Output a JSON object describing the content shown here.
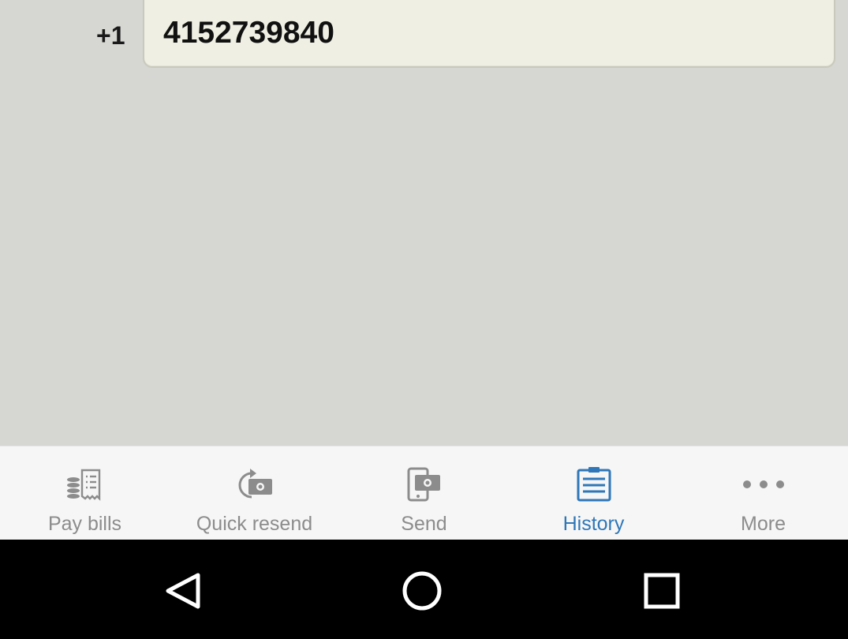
{
  "phone": {
    "country_code": "+1",
    "number": "4152739840"
  },
  "tabs": [
    {
      "id": "pay-bills",
      "label": "Pay bills",
      "icon": "receipt-coins-icon",
      "active": false
    },
    {
      "id": "quick-resend",
      "label": "Quick resend",
      "icon": "resend-money-icon",
      "active": false
    },
    {
      "id": "send",
      "label": "Send",
      "icon": "send-money-phone-icon",
      "active": false
    },
    {
      "id": "history",
      "label": "History",
      "icon": "clipboard-list-icon",
      "active": true
    },
    {
      "id": "more",
      "label": "More",
      "icon": "more-dots-icon",
      "active": false
    }
  ],
  "system_nav": {
    "back": "back-triangle-icon",
    "home": "home-circle-icon",
    "recents": "recents-square-icon"
  },
  "colors": {
    "background": "#d6d6d2",
    "field_background": "#efefe3",
    "tab_inactive": "#8c8c8c",
    "tab_active": "#2f77b8",
    "nav_bar": "#000000"
  }
}
